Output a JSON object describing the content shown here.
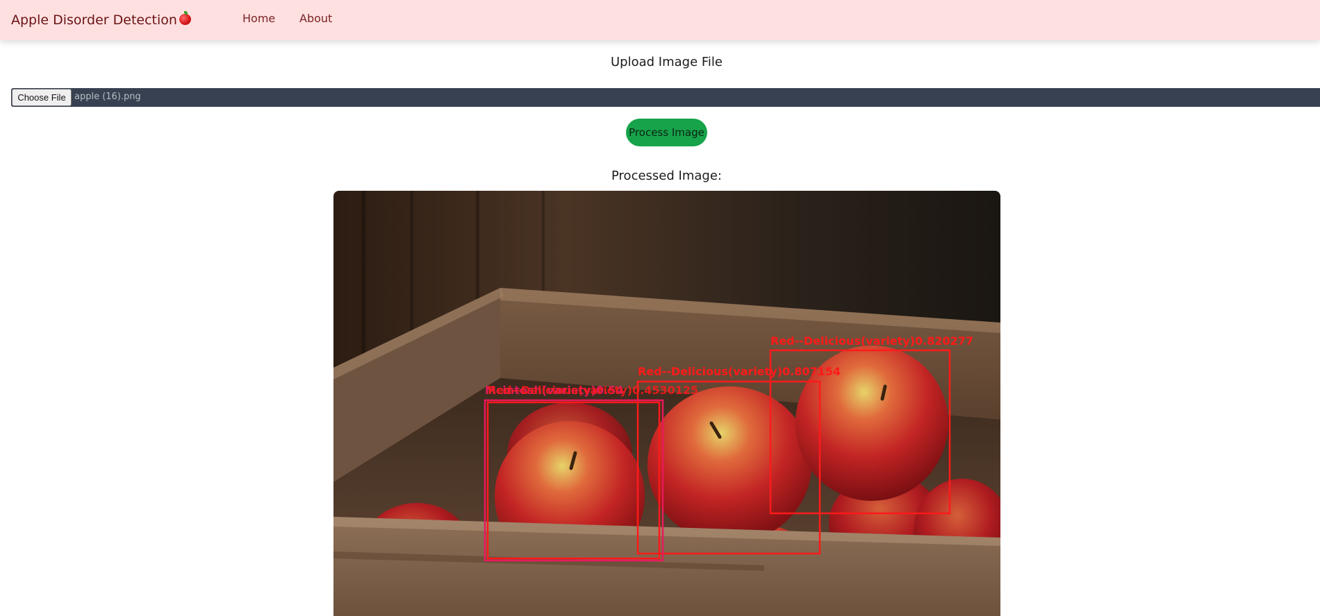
{
  "navbar": {
    "brand": "Apple Disorder Detection",
    "brand_icon": "red-apple-icon",
    "links": [
      "Home",
      "About"
    ],
    "background": "#ffe0e1"
  },
  "upload": {
    "title": "Upload Image File",
    "choose_label": "Choose File",
    "file_name": "apple (16).png"
  },
  "process_button": {
    "label": "Process Image",
    "color": "#16a34a"
  },
  "result": {
    "title": "Processed Image:",
    "detections": [
      {
        "label": "Red--Delicious(variety)0.820277",
        "color": "#ff1a1a"
      },
      {
        "label": "Red--Delicious(variety)0.807154",
        "color": "#ff1a1a"
      },
      {
        "label": "Mcintosh(variety)0.54",
        "color": "#e8195a"
      },
      {
        "label": "Red--Delicious(variety)0.4530125",
        "color": "#ff1a1a"
      }
    ]
  }
}
